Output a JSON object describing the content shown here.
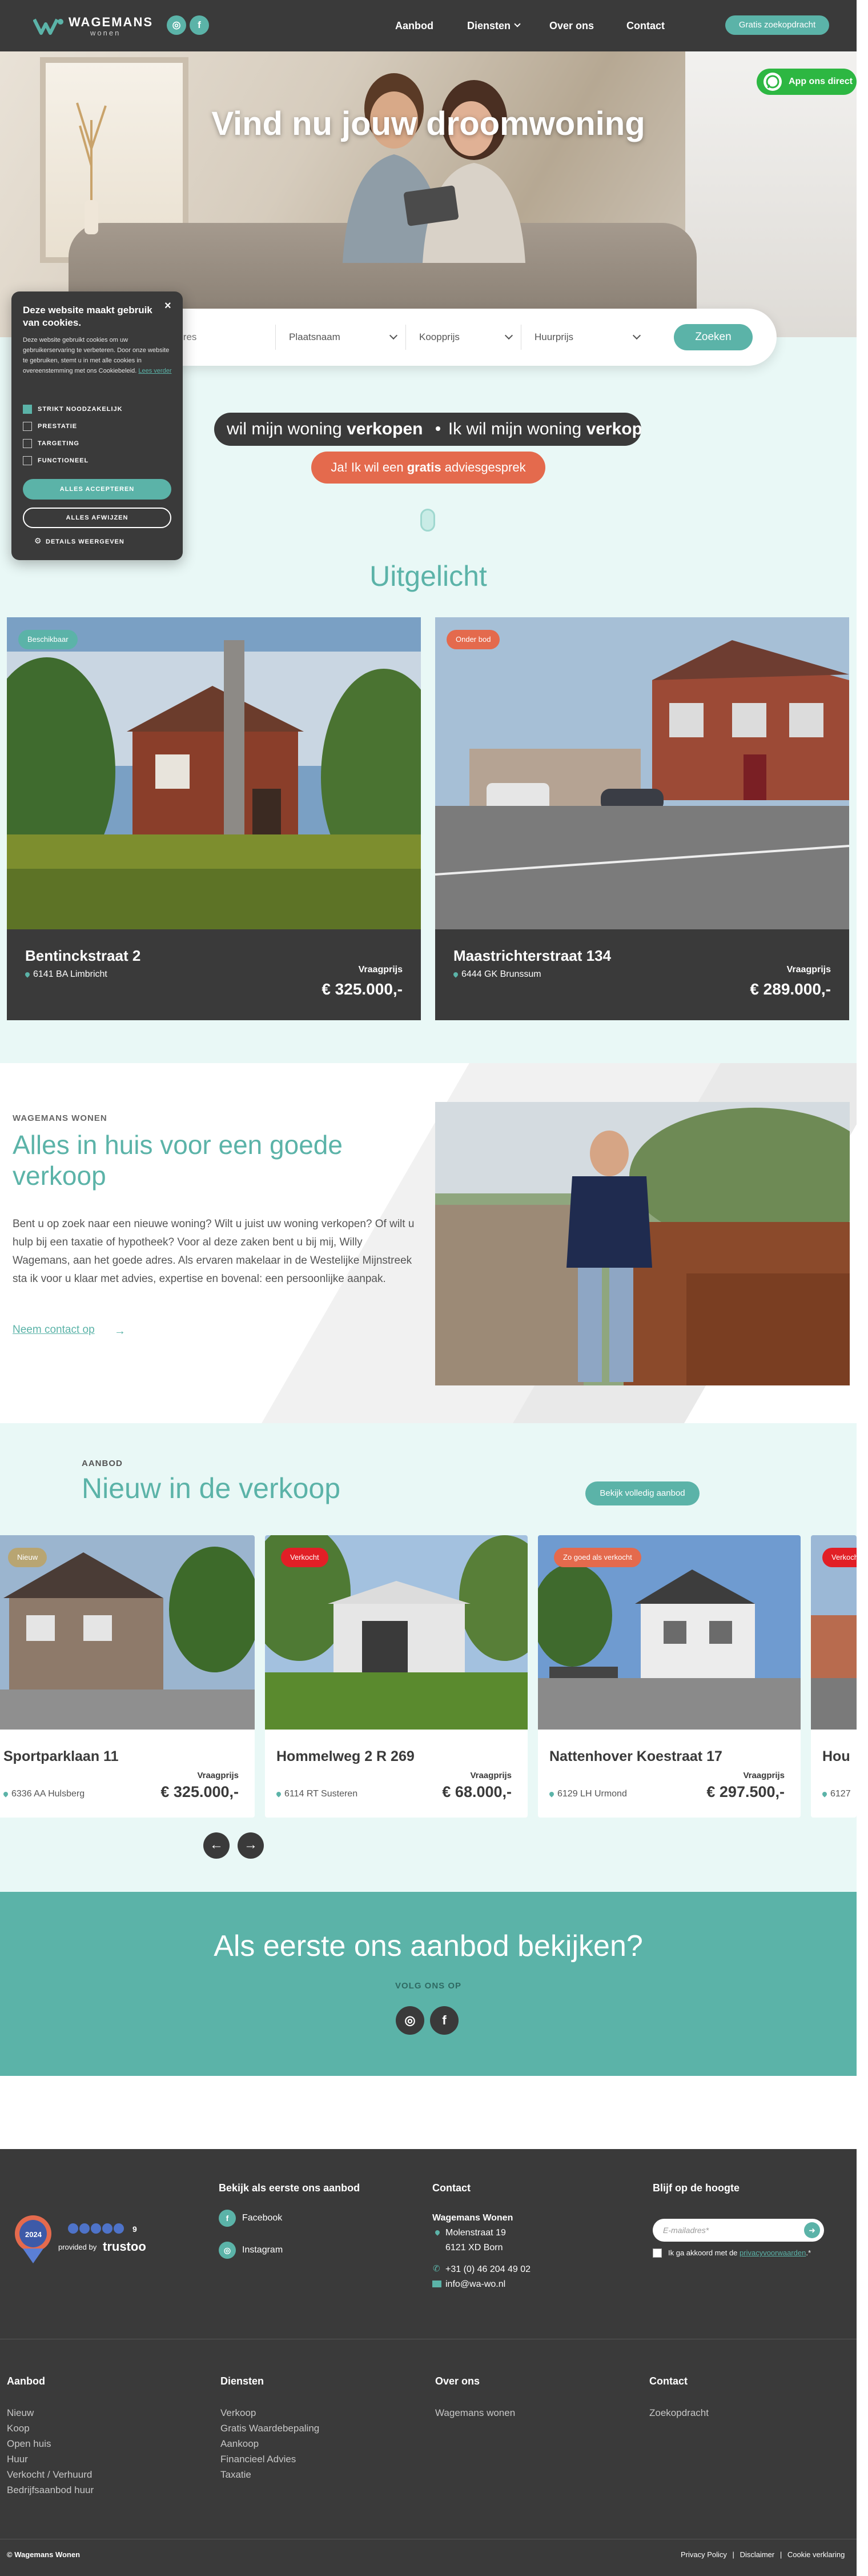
{
  "header": {
    "logo_word": "WAGEMANS",
    "logo_sub": "wonen",
    "social": [
      "instagram-icon",
      "facebook-icon"
    ],
    "nav": [
      {
        "label": "Aanbod"
      },
      {
        "label": "Diensten"
      },
      {
        "label": "Over ons"
      },
      {
        "label": "Contact"
      }
    ],
    "cta_label": "Gratis zoekopdracht"
  },
  "hero": {
    "title": "Vind nu jouw droomwoning",
    "whatsapp_label": "App ons direct",
    "search": {
      "address_placeholder": "Adres",
      "fields": [
        "Plaatsnaam",
        "Koopprijs",
        "Huurprijs"
      ],
      "button_label": "Zoeken"
    }
  },
  "intent": {
    "pill_prefix_1": "wil mijn woning ",
    "pill_strong_1": "verkopen",
    "pill_prefix_2": "Ik wil mijn woning ",
    "pill_strong_2": "verkop",
    "advice_prefix": "Ja! Ik wil een ",
    "advice_strong": "gratis",
    "advice_suffix": " adviesgesprek"
  },
  "featured": {
    "title": "Uitgelicht",
    "items": [
      {
        "badge": "Beschikbaar",
        "badge_color": "#5bb3a8",
        "title": "Bentinckstraat 2",
        "location": "6141 BA Limbricht",
        "price_label": "Vraagprijs",
        "price": "€ 325.000,-"
      },
      {
        "badge": "Onder bod",
        "badge_color": "#e46a4d",
        "title": "Maastrichterstraat 134",
        "location": "6444 GK Brunssum",
        "price_label": "Vraagprijs",
        "price": "€ 289.000,-"
      }
    ]
  },
  "about": {
    "kicker": "WAGEMANS WONEN",
    "title": "Alles in huis voor een goede verkoop",
    "text": "Bent u op zoek naar een nieuwe woning? Wilt u juist uw woning verkopen? Of wilt u hulp bij een taxatie of hypotheek? Voor al deze zaken bent u bij mij, Willy Wagemans, aan het goede adres. Als ervaren makelaar in de Westelijke Mijnstreek sta ik voor u klaar met advies, expertise en bovenal: een persoonlijke aanpak.",
    "link_label": "Neem contact op"
  },
  "listings": {
    "kicker": "AANBOD",
    "title": "Nieuw in de verkoop",
    "button_label": "Bekijk volledig aanbod",
    "items": [
      {
        "badge": "Nieuw",
        "badge_color": "#b8a572",
        "title": "Sportparklaan 11",
        "location": "6336 AA Hulsberg",
        "price_label": "Vraagprijs",
        "price": "€ 325.000,-"
      },
      {
        "badge": "Verkocht",
        "badge_color": "#e21f26",
        "title": "Hommelweg 2 R 269",
        "location": "6114 RT Susteren",
        "price_label": "Vraagprijs",
        "price": "€ 68.000,-"
      },
      {
        "badge": "Zo goed als verkocht",
        "badge_color": "#e46a4d",
        "title": "Nattenhover Koestraat 17",
        "location": "6129 LH Urmond",
        "price_label": "Vraagprijs",
        "price": "€ 297.500,-"
      },
      {
        "badge": "Verkocht",
        "badge_color": "#e21f26",
        "title": "Hou",
        "location": "6127",
        "price_label": "",
        "price": ""
      }
    ]
  },
  "cta": {
    "title": "Als eerste ons aanbod bekijken?",
    "kicker": "VOLG ONS OP",
    "social": [
      "instagram-icon",
      "facebook-icon"
    ]
  },
  "footer": {
    "rating": {
      "year": "2024",
      "score": "9",
      "provider_prefix": "provided by",
      "provider": "trustoo"
    },
    "social_heading": "Bekijk als eerste ons aanbod",
    "social_links": [
      "Facebook",
      "Instagram"
    ],
    "contact_heading": "Contact",
    "company": "Wagemans Wonen",
    "address_1": "Molenstraat 19",
    "address_2": "6121 XD Born",
    "phone": "+31 (0) 46 204 49 02",
    "email": "info@wa-wo.nl",
    "newsletter_heading": "Blijf op de hoogte",
    "email_placeholder": "E-mailadres*",
    "consent_prefix": "Ik ga akkoord met de ",
    "consent_link": "privacyvoorwaarden",
    "consent_suffix": ".*",
    "columns": [
      {
        "heading": "Aanbod",
        "links": [
          "Nieuw",
          "Koop",
          "Open huis",
          "Huur",
          "Verkocht / Verhuurd",
          "Bedrijfsaanbod huur"
        ]
      },
      {
        "heading": "Diensten",
        "links": [
          "Verkoop",
          "Gratis Waardebepaling",
          "Aankoop",
          "Financieel Advies",
          "Taxatie"
        ]
      },
      {
        "heading": "Over ons",
        "links": [
          "Wagemans wonen"
        ]
      },
      {
        "heading": "Contact",
        "links": [
          "Zoekopdracht"
        ]
      }
    ],
    "copyright": "© Wagemans Wonen",
    "legal": [
      "Privacy Policy",
      "Disclaimer",
      "Cookie verklaring"
    ]
  },
  "cookie": {
    "title": "Deze website maakt gebruik van cookies.",
    "text": "Deze website gebruikt cookies om uw gebruikerservaring te verbeteren. Door onze website te gebruiken, stemt u in met alle cookies in overeenstemming met ons Cookiebeleid.",
    "read_more": "Lees verder",
    "options": [
      {
        "label": "STRIKT NOODZAKELIJK",
        "checked": true
      },
      {
        "label": "PRESTATIE",
        "checked": false
      },
      {
        "label": "TARGETING",
        "checked": false
      },
      {
        "label": "FUNCTIONEEL",
        "checked": false
      }
    ],
    "accept_label": "ALLES ACCEPTEREN",
    "decline_label": "ALLES AFWIJZEN",
    "details_label": "DETAILS WEERGEVEN"
  },
  "colors": {
    "teal": "#5bb3a8",
    "dark": "#3a3a3a",
    "light_teal": "#e9f8f6",
    "coral": "#e46a4d",
    "red": "#e21f26"
  }
}
